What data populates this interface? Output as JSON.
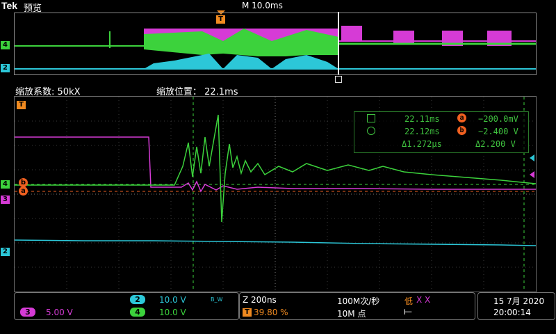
{
  "header": {
    "brand": "Tek",
    "mode": "预览",
    "timebase": "M 10.0ms"
  },
  "zoom": {
    "factor_label": "缩放系数: 50kX",
    "position_label": "缩放位置： 22.1ms"
  },
  "trigger_marker": "T",
  "channels": {
    "ch2": {
      "tag": "2",
      "color": "#2cc7d8",
      "scale": "10.0 V",
      "bw": "B_W"
    },
    "ch3": {
      "tag": "3",
      "color": "#d63bd6",
      "scale": "5.00 V"
    },
    "ch4": {
      "tag": "4",
      "color": "#3cd23c",
      "scale": "10.0 V"
    }
  },
  "cursors": {
    "a_label": "a",
    "b_label": "b",
    "time1": "22.11ms",
    "time2": "22.12ms",
    "dtime": "Δ1.272μs",
    "val_a": "−200.0mV",
    "val_b": "−2.400 V",
    "dval": "Δ2.200 V"
  },
  "acquisition": {
    "zoom_time": "Z 200ns",
    "trigger_pos": "39.80 %",
    "sample_rate": "100M次/秒",
    "record_length": "10M 点",
    "resolution": "低",
    "xx": "X X",
    "trigger_symbol": "⟝"
  },
  "datetime": {
    "date": "15 7月 2020",
    "time": "20:00:14"
  }
}
